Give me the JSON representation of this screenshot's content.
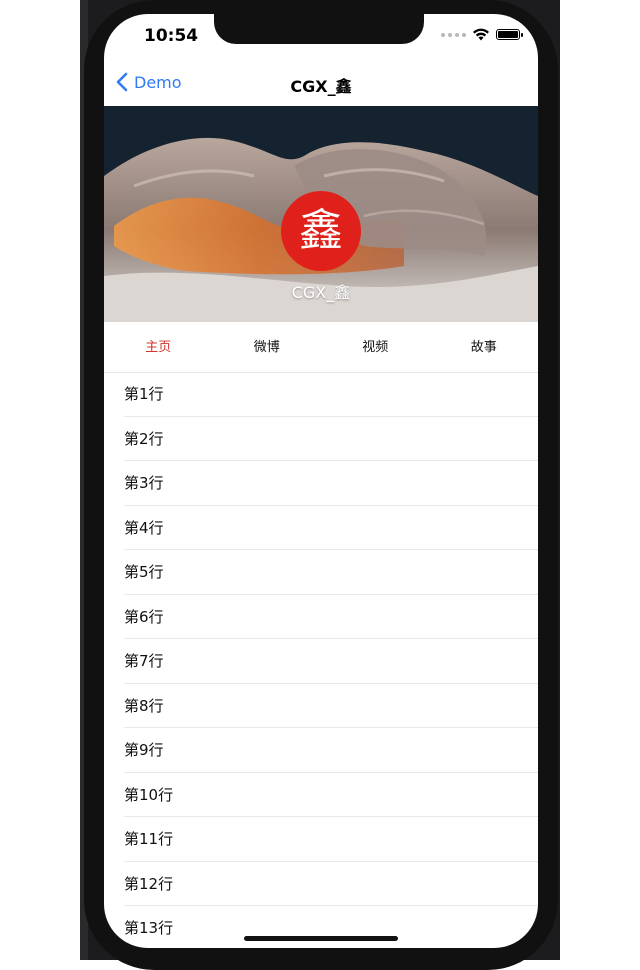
{
  "status_bar": {
    "time": "10:54"
  },
  "nav": {
    "back_label": "Demo",
    "title": "CGX_鑫"
  },
  "profile": {
    "avatar_text": "鑫",
    "name": "CGX_鑫"
  },
  "tabs": [
    {
      "label": "主页",
      "active": true
    },
    {
      "label": "微博",
      "active": false
    },
    {
      "label": "视频",
      "active": false
    },
    {
      "label": "故事",
      "active": false
    }
  ],
  "rows": [
    "第1行",
    "第2行",
    "第3行",
    "第4行",
    "第5行",
    "第6行",
    "第7行",
    "第8行",
    "第9行",
    "第10行",
    "第11行",
    "第12行",
    "第13行"
  ],
  "colors": {
    "accent_blue": "#2f7cf6",
    "tab_active": "#d0332c",
    "avatar_bg": "#e0211b"
  }
}
